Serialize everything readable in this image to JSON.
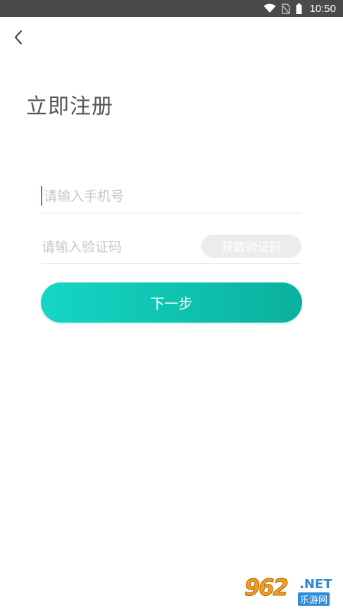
{
  "status_bar": {
    "time": "10:50",
    "icons": [
      "wifi-icon",
      "no-sim-icon",
      "battery-icon"
    ]
  },
  "header": {
    "back_icon": "chevron-left-icon"
  },
  "page": {
    "title": "立即注册"
  },
  "form": {
    "phone_placeholder": "请输入手机号",
    "phone_value": "",
    "code_placeholder": "请输入验证码",
    "code_value": "",
    "get_code_label": "获取验证码",
    "next_label": "下一步"
  },
  "colors": {
    "accent_start": "#16d6c5",
    "accent_end": "#0bb09e",
    "status_bar": "#4a4a4a"
  },
  "watermark": {
    "number": "962",
    "domain": ".NET",
    "site_name": "乐游网"
  }
}
